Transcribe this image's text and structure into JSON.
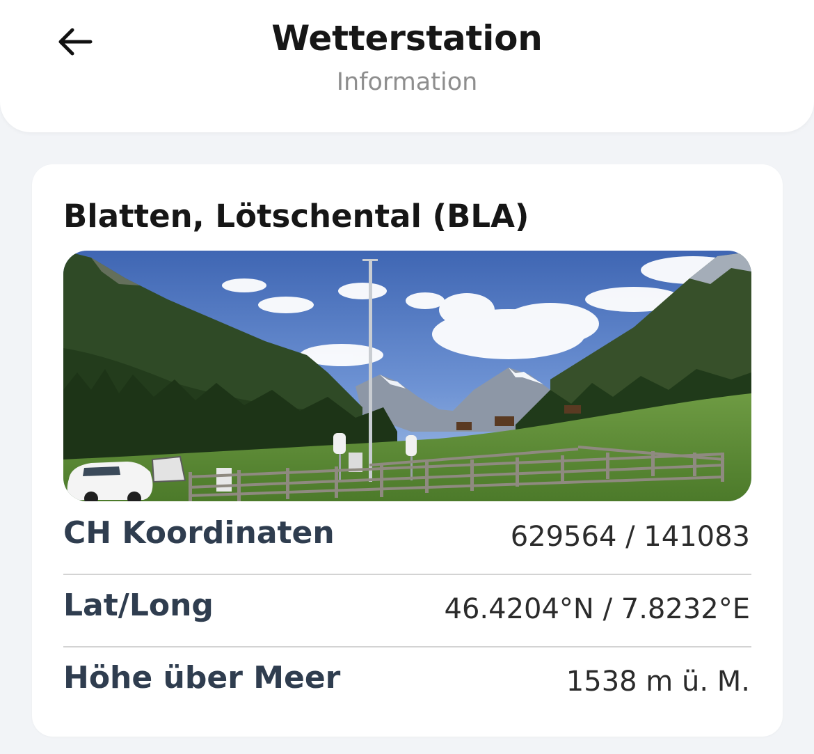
{
  "header": {
    "title": "Wetterstation",
    "subtitle": "Information",
    "back_icon": "arrow-left-icon"
  },
  "station": {
    "name": "Blatten, Lötschental (BLA)",
    "photo_alt": "Wetterstation Blatten, Lötschental",
    "rows": [
      {
        "label": "CH Koordinaten",
        "value": "629564 / 141083"
      },
      {
        "label": "Lat/Long",
        "value": "46.4204°N / 7.8232°E"
      },
      {
        "label": "Höhe über Meer",
        "value": "1538 m ü. M."
      }
    ]
  },
  "colors": {
    "page_background": "#f2f4f7",
    "card_background": "#ffffff",
    "label_color": "#2f3d4f",
    "value_color": "#2b2b2b",
    "subtitle_color": "#8e8e8e",
    "divider_color": "#d3d3d3"
  }
}
